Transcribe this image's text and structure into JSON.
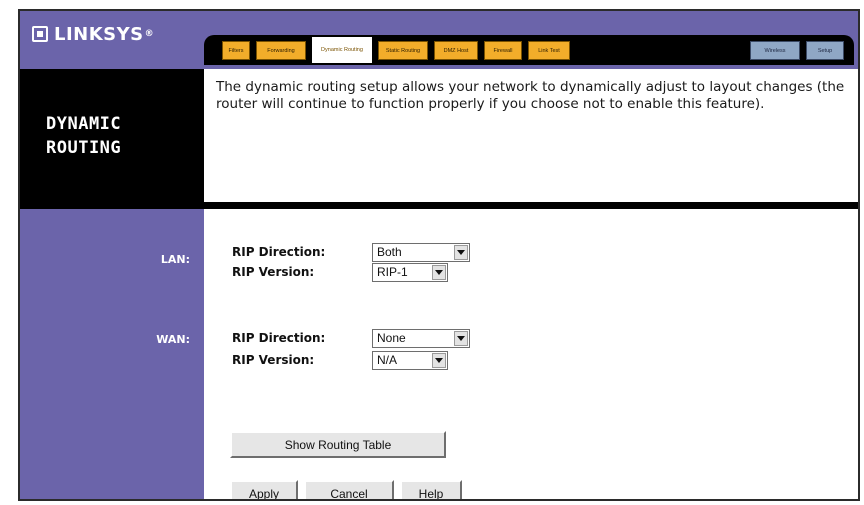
{
  "brand": {
    "name": "LINKSYS",
    "registered": "®"
  },
  "tabs": [
    {
      "label": "Filters",
      "state": "inactive"
    },
    {
      "label": "Forwarding",
      "state": "inactive"
    },
    {
      "label": "Dynamic Routing",
      "state": "active"
    },
    {
      "label": "Static Routing",
      "state": "inactive"
    },
    {
      "label": "DMZ Host",
      "state": "inactive"
    },
    {
      "label": "Firewall",
      "state": "inactive"
    },
    {
      "label": "Link Test",
      "state": "inactive"
    },
    {
      "label": "Wireless",
      "state": "inactive"
    },
    {
      "label": "Setup",
      "state": "inactive"
    }
  ],
  "page": {
    "title_line1": "DYNAMIC",
    "title_line2": "ROUTING",
    "description": "The dynamic routing setup allows your network to dynamically adjust to layout changes (the router will continue to function properly if you choose not to enable this feature)."
  },
  "lan": {
    "label": "LAN:",
    "rip_direction_label": "RIP Direction:",
    "rip_direction_value": "Both",
    "rip_version_label": "RIP Version:",
    "rip_version_value": "RIP-1"
  },
  "wan": {
    "label": "WAN:",
    "rip_direction_label": "RIP Direction:",
    "rip_direction_value": "None",
    "rip_version_label": "RIP Version:",
    "rip_version_value": "N/A"
  },
  "buttons": {
    "show_routing_table": "Show Routing Table",
    "apply": "Apply",
    "cancel": "Cancel",
    "help": "Help"
  },
  "colors": {
    "sidebar_purple": "#6b64aa",
    "tab_orange": "#f2ad2a",
    "tab_blue": "#8fa7c5",
    "title_black": "#000000"
  }
}
